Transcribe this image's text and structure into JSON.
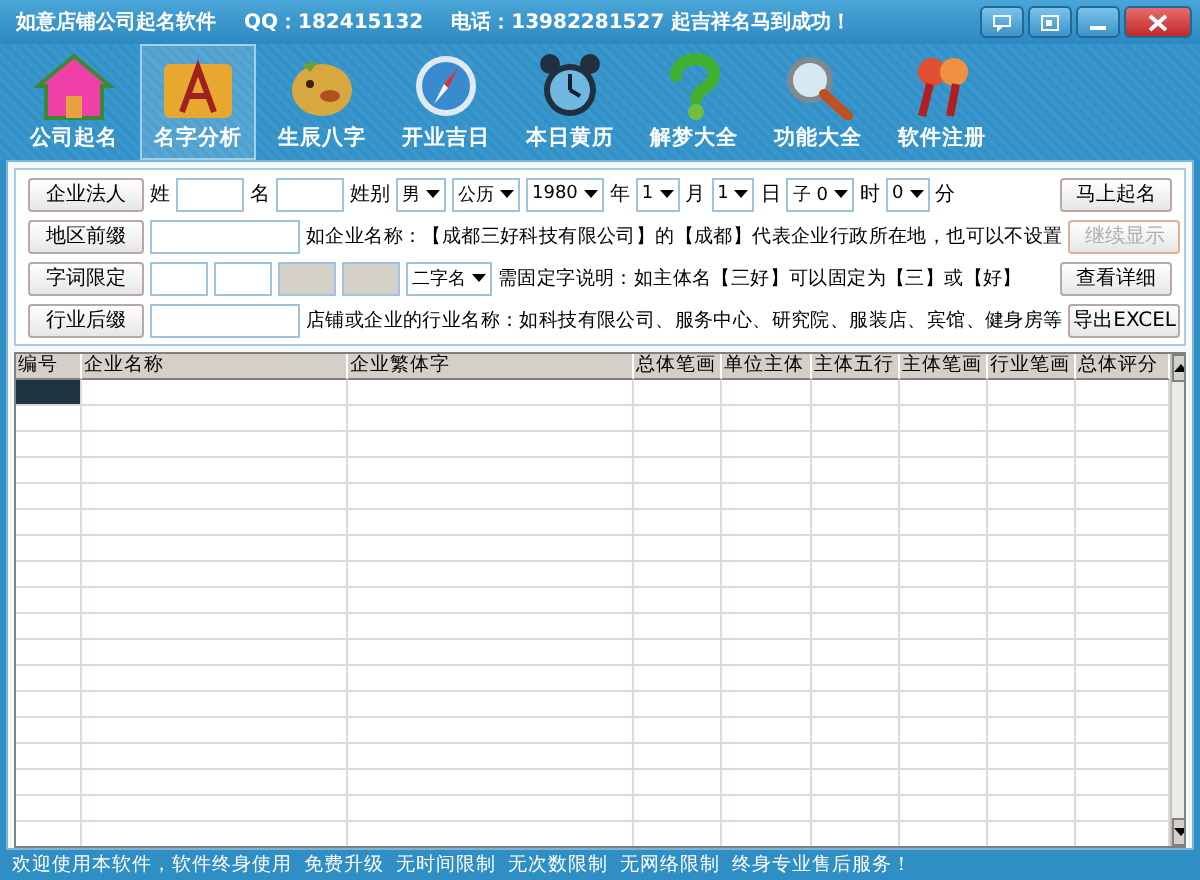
{
  "window": {
    "title": "如意店铺公司起名软件",
    "qq": "QQ：182415132",
    "phone": "电话：13982281527 起吉祥名马到成功！"
  },
  "toolbar": [
    {
      "label": "公司起名",
      "selected": false
    },
    {
      "label": "名字分析",
      "selected": true
    },
    {
      "label": "生辰八字",
      "selected": false
    },
    {
      "label": "开业吉日",
      "selected": false
    },
    {
      "label": "本日黄历",
      "selected": false
    },
    {
      "label": "解梦大全",
      "selected": false
    },
    {
      "label": "功能大全",
      "selected": false
    },
    {
      "label": "软件注册",
      "selected": false
    }
  ],
  "form": [
    {
      "label": "企业法人",
      "items": [
        {
          "kind": "label",
          "text": "姓"
        },
        {
          "kind": "input",
          "disabled": false
        },
        {
          "kind": "label",
          "text": "名"
        },
        {
          "kind": "input",
          "disabled": false
        },
        {
          "kind": "label",
          "text": "姓别"
        },
        {
          "kind": "select",
          "value": "男"
        },
        {
          "kind": "select",
          "value": "公历"
        },
        {
          "kind": "select",
          "value": "1980"
        },
        {
          "kind": "label",
          "text": "年"
        },
        {
          "kind": "select",
          "value": "1"
        },
        {
          "kind": "label",
          "text": "月"
        },
        {
          "kind": "select",
          "value": "1"
        },
        {
          "kind": "label",
          "text": "日"
        },
        {
          "kind": "select",
          "value": "子 0"
        },
        {
          "kind": "label",
          "text": "时"
        },
        {
          "kind": "select",
          "value": "0"
        },
        {
          "kind": "label",
          "text": "分"
        }
      ],
      "action": {
        "label": "马上起名",
        "disabled": false
      }
    },
    {
      "label": "地区前缀",
      "items": [
        {
          "kind": "input",
          "disabled": false
        },
        {
          "kind": "text",
          "text": "如企业名称：【成都三好科技有限公司】的【成都】代表企业行政所在地，也可以不设置"
        }
      ],
      "action": {
        "label": "继续显示",
        "disabled": true
      }
    },
    {
      "label": "字词限定",
      "items": [
        {
          "kind": "input",
          "disabled": false
        },
        {
          "kind": "input",
          "disabled": false
        },
        {
          "kind": "input",
          "disabled": true
        },
        {
          "kind": "input",
          "disabled": true
        },
        {
          "kind": "select",
          "value": "二字名"
        },
        {
          "kind": "text",
          "text": "需固定字说明：如主体名【三好】可以固定为【三】或【好】"
        }
      ],
      "action": {
        "label": "查看详细",
        "disabled": false
      }
    },
    {
      "label": "行业后缀",
      "items": [
        {
          "kind": "input",
          "disabled": false
        },
        {
          "kind": "text",
          "text": "店铺或企业的行业名称：如科技有限公司、服务中心、研究院、服装店、宾馆、健身房等"
        }
      ],
      "action": {
        "label": "导出EXCEL",
        "disabled": false
      }
    }
  ],
  "table": {
    "columns": [
      "编号",
      "企业名称",
      "企业繁体字",
      "总体笔画",
      "单位主体",
      "主体五行",
      "主体笔画",
      "行业笔画",
      "总体评分"
    ],
    "rows": [
      {
        "selected": true
      },
      {
        "selected": false
      },
      {
        "selected": false
      },
      {
        "selected": false
      },
      {
        "selected": false
      },
      {
        "selected": false
      },
      {
        "selected": false
      },
      {
        "selected": false
      },
      {
        "selected": false
      },
      {
        "selected": false
      },
      {
        "selected": false
      },
      {
        "selected": false
      },
      {
        "selected": false
      },
      {
        "selected": false
      },
      {
        "selected": false
      },
      {
        "selected": false
      },
      {
        "selected": false
      },
      {
        "selected": false
      }
    ]
  },
  "status_bar": "欢迎使用本软件，软件终身使用  免费升级  无时间限制  无次数限制  无网络限制  终身专业售后服务！"
}
